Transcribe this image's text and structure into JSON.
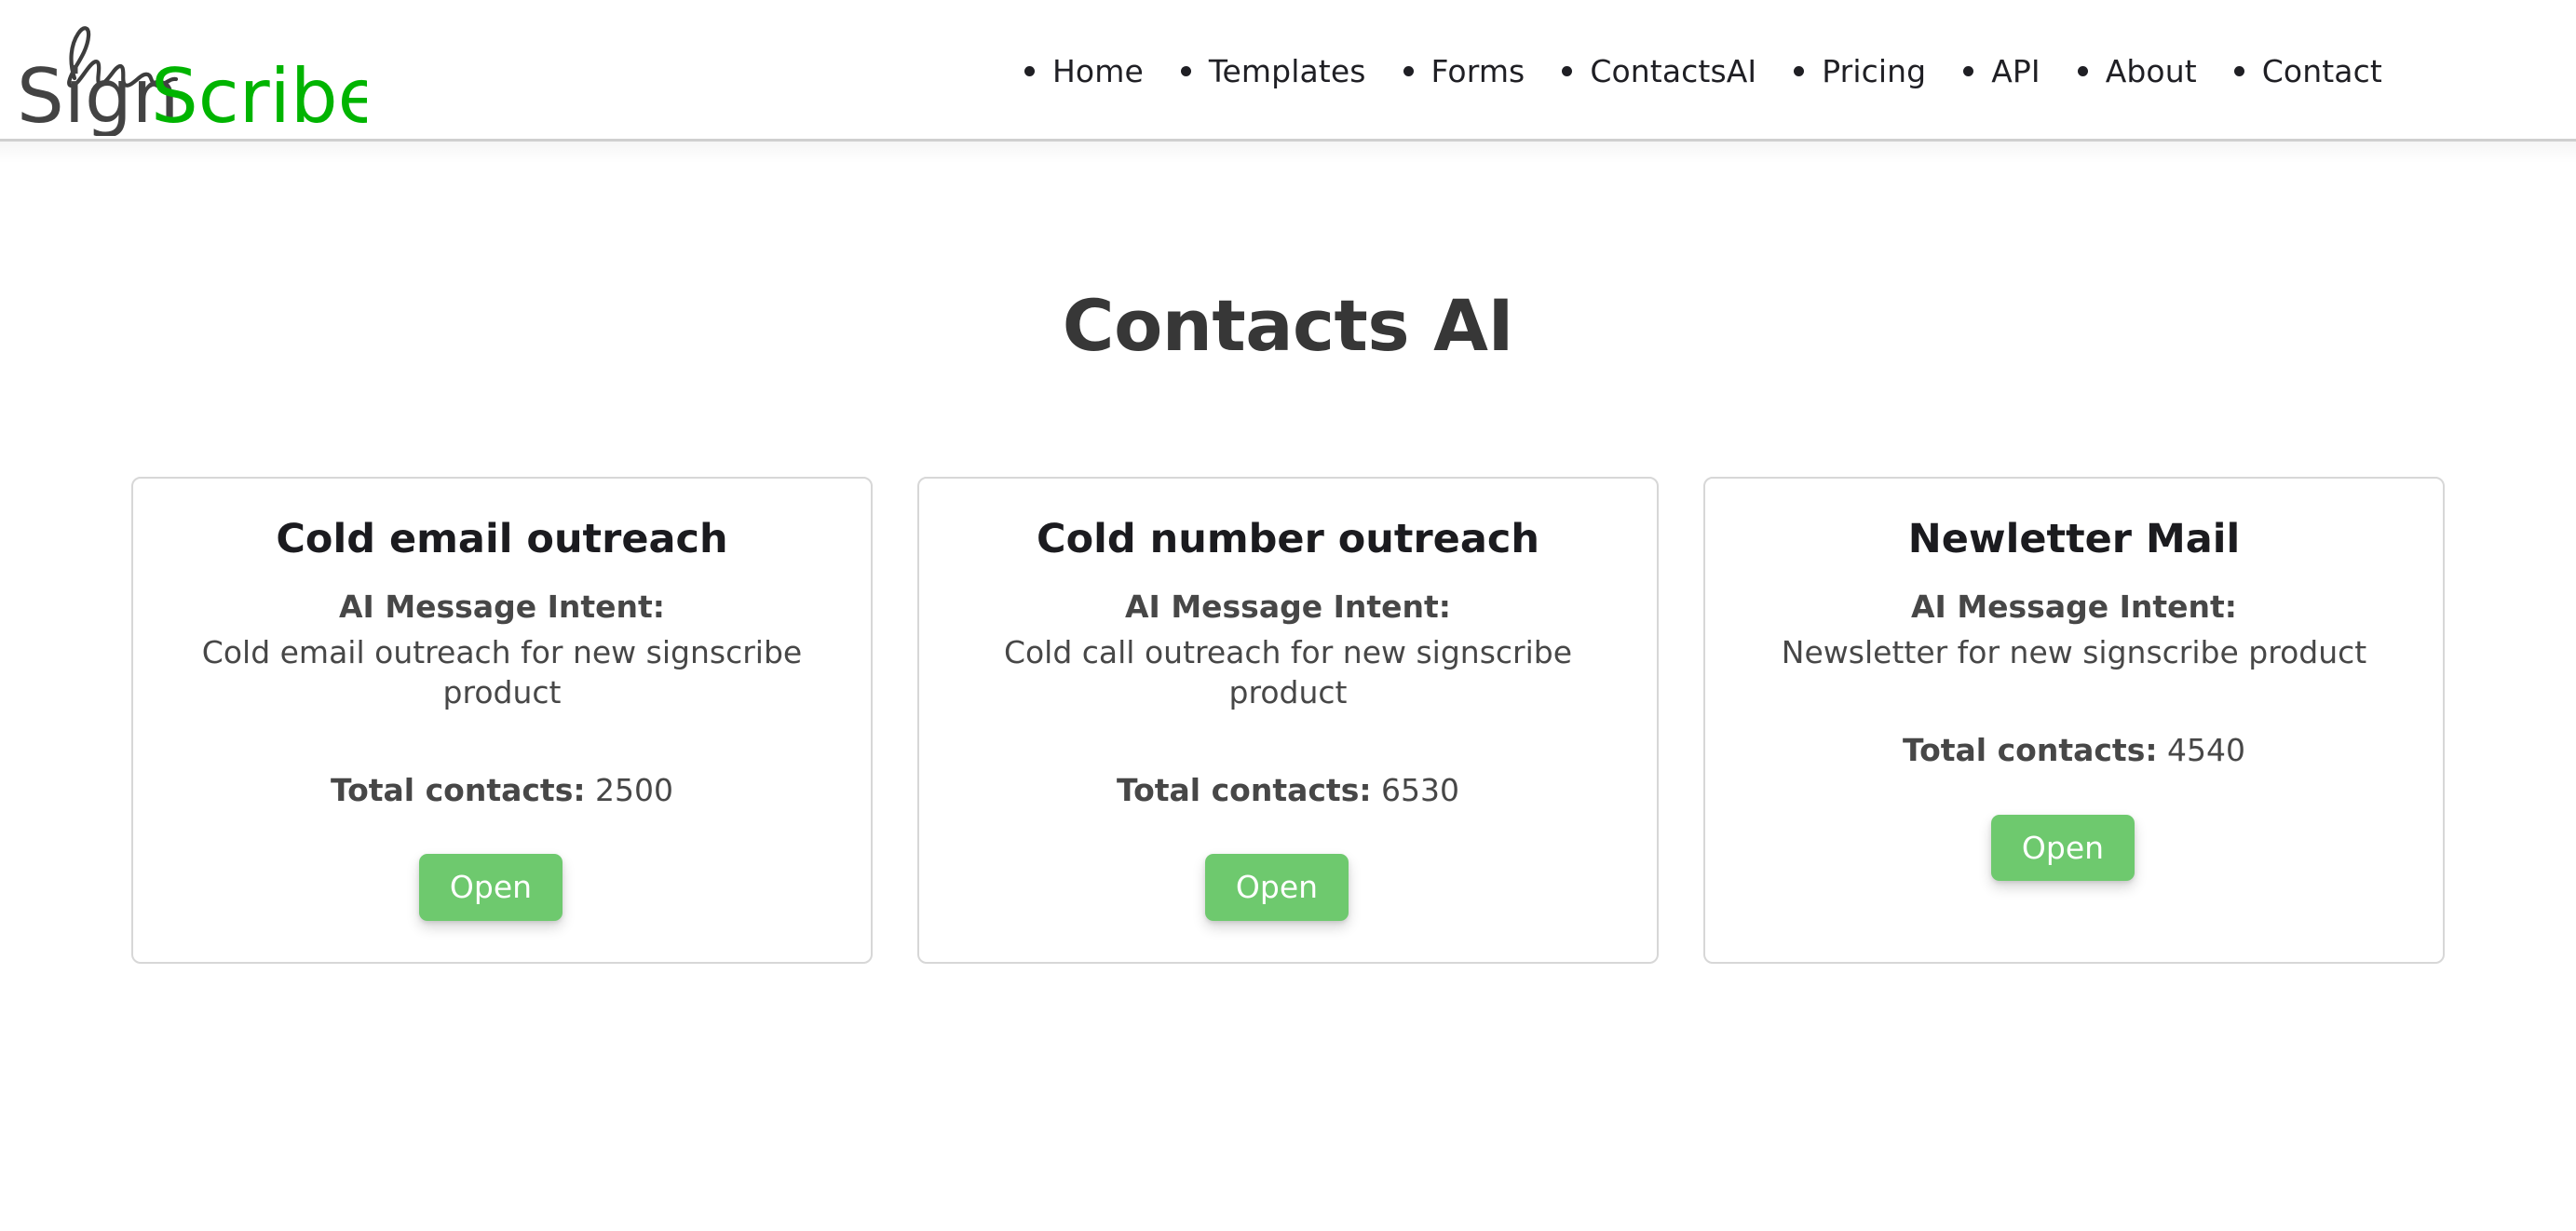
{
  "brand": {
    "name_part_dark": "Sign",
    "name_part_green": "Scribe",
    "dark_color": "#434343",
    "green_color": "#00b400",
    "signature_icon": "signature-squiggle-icon"
  },
  "nav": {
    "items": [
      {
        "label": "Home",
        "bullet": "bullet-icon"
      },
      {
        "label": "Templates",
        "bullet": "bullet-icon"
      },
      {
        "label": "Forms",
        "bullet": "bullet-icon"
      },
      {
        "label": "ContactsAI",
        "bullet": "bullet-icon"
      },
      {
        "label": "Pricing",
        "bullet": "bullet-icon"
      },
      {
        "label": "API",
        "bullet": "bullet-icon"
      },
      {
        "label": "About",
        "bullet": "bullet-icon"
      },
      {
        "label": "Contact",
        "bullet": "bullet-icon"
      }
    ]
  },
  "main": {
    "title": "Contacts AI",
    "intent_label": "AI Message Intent:",
    "total_label": "Total contacts:",
    "open_label": "Open",
    "accent_green": "#6ec96e",
    "cards": [
      {
        "title": "Cold email outreach",
        "intent_label": "AI Message Intent:",
        "intent_value": "Cold email outreach for new signscribe product",
        "total_label": "Total contacts:",
        "total_value": "2500",
        "open_label": "Open"
      },
      {
        "title": "Cold number outreach",
        "intent_label": "AI Message Intent:",
        "intent_value": "Cold call outreach for new signscribe product",
        "total_label": "Total contacts:",
        "total_value": "6530",
        "open_label": "Open"
      },
      {
        "title": "Newletter Mail",
        "intent_label": "AI Message Intent:",
        "intent_value": "Newsletter for new signscribe product",
        "total_label": "Total contacts:",
        "total_value": "4540",
        "open_label": "Open"
      }
    ]
  }
}
